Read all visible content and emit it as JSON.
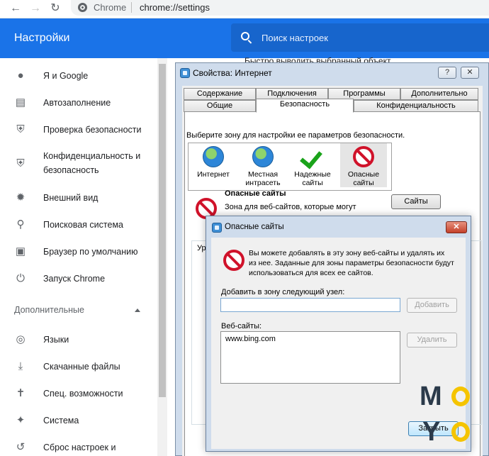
{
  "browser": {
    "back_icon": "arrow-left-icon",
    "forward_icon": "arrow-right-icon",
    "reload_icon": "reload-icon",
    "site_label": "Chrome",
    "url": "chrome://settings"
  },
  "header": {
    "title": "Настройки",
    "search_placeholder": "Поиск настроек"
  },
  "background_page": {
    "partial_text": "Быстро выводить выбранный объект"
  },
  "sidebar": {
    "items": [
      {
        "label": "Я и Google",
        "icon": "person-icon"
      },
      {
        "label": "Автозаполнение",
        "icon": "clipboard-icon"
      },
      {
        "label": "Проверка безопасности",
        "icon": "shield-check-icon"
      },
      {
        "label_line1": "Конфиденциальность и",
        "label_line2": "безопасность",
        "icon": "shield-icon"
      },
      {
        "label": "Внешний вид",
        "icon": "palette-icon"
      },
      {
        "label": "Поисковая система",
        "icon": "search-icon"
      },
      {
        "label": "Браузер по умолчанию",
        "icon": "browser-icon"
      },
      {
        "label": "Запуск Chrome",
        "icon": "power-icon"
      }
    ],
    "advanced_label": "Дополнительные",
    "advanced_items": [
      {
        "label": "Языки",
        "icon": "globe-icon"
      },
      {
        "label": "Скачанные файлы",
        "icon": "download-icon"
      },
      {
        "label": "Спец. возможности",
        "icon": "accessibility-icon"
      },
      {
        "label": "Система",
        "icon": "wrench-icon"
      },
      {
        "label": "Сброс настроек и",
        "icon": "reset-icon"
      }
    ]
  },
  "internet_properties": {
    "title": "Свойства: Интернет",
    "help_label": "?",
    "close_label": "✕",
    "tabs_row1": [
      "Содержание",
      "Подключения",
      "Программы",
      "Дополнительно"
    ],
    "tabs_row2": [
      "Общие",
      "Безопасность",
      "Конфиденциальность"
    ],
    "active_tab": "Безопасность",
    "zone_prompt": "Выберите зону для настройки ее параметров безопасности.",
    "zones": [
      {
        "line1": "Интернет",
        "line2": ""
      },
      {
        "line1": "Местная",
        "line2": "интрасеть"
      },
      {
        "line1": "Надежные",
        "line2": "сайты"
      },
      {
        "line1": "Опасные",
        "line2": "сайты"
      }
    ],
    "selected_zone_title": "Опасные сайты",
    "selected_zone_desc": "Зона для веб-сайтов, которые могут",
    "sites_button": "Сайты",
    "groupbox_label": "Ур"
  },
  "restricted_sites_dialog": {
    "title": "Опасные сайты",
    "close_label": "✕",
    "info_line1": "Вы можете добавлять в эту зону  веб-сайты и удалять их",
    "info_line2": "из нее. Заданные для зоны параметры безопасности будут",
    "info_line3": "использоваться для всех ее сайтов.",
    "add_label": "Добавить в зону следующий узел:",
    "add_input_value": "",
    "add_button": "Добавить",
    "sites_label": "Веб-сайты:",
    "sites": [
      "www.bing.com"
    ],
    "remove_button": "Удалить",
    "close_button": "Закрыть"
  },
  "watermark": {
    "letters": [
      "M",
      "O",
      "Y",
      "O"
    ],
    "dark_color": "#2b3a4a",
    "accent_color": "#f5c400"
  }
}
